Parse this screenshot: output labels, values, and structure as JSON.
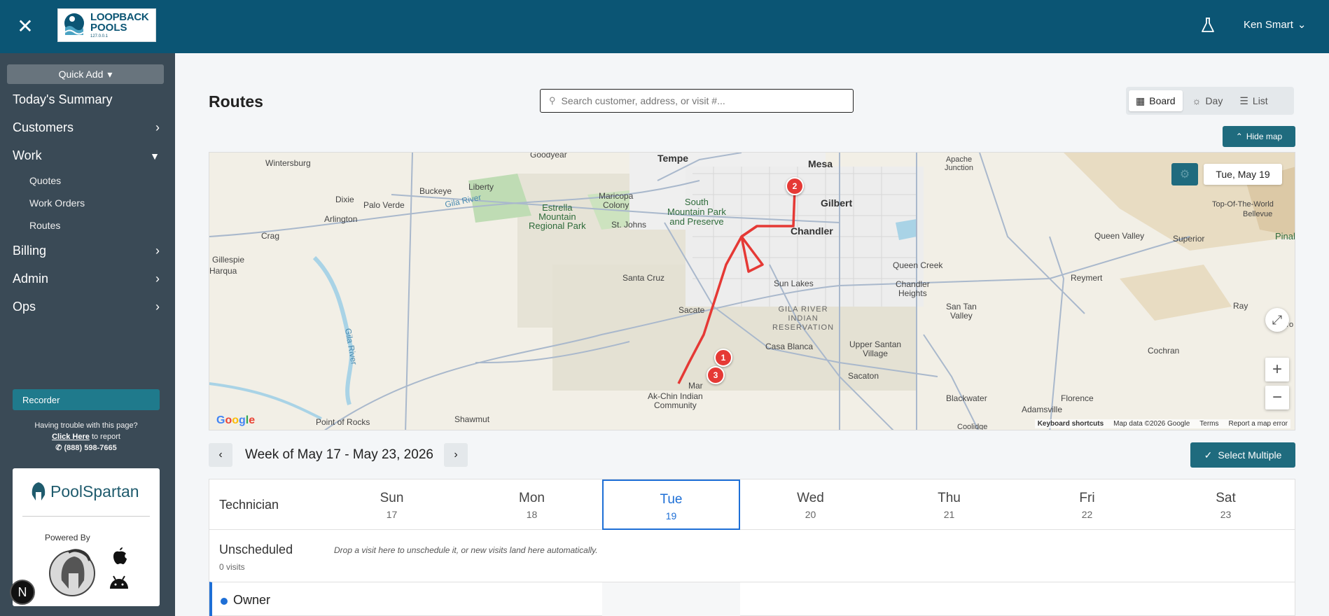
{
  "header": {
    "logo": {
      "line1": "LOOPBACK",
      "line2": "POOLS",
      "line3": "127.0.0.1"
    },
    "user_name": "Ken Smart"
  },
  "sidebar": {
    "quick_add": "Quick Add",
    "items": [
      {
        "label": "Today's Summary"
      },
      {
        "label": "Customers"
      },
      {
        "label": "Work"
      },
      {
        "label": "Billing"
      },
      {
        "label": "Admin"
      },
      {
        "label": "Ops"
      }
    ],
    "work_sub": [
      "Quotes",
      "Work Orders",
      "Routes"
    ],
    "recorder": "Recorder",
    "help": {
      "line1": "Having trouble with this page?",
      "link": "Click Here",
      "link_suffix": " to report",
      "phone": "(888) 598-7665"
    },
    "spartan": {
      "name": "PoolSpartan",
      "powered_by": "Powered By"
    },
    "badge": "N"
  },
  "main": {
    "title": "Routes",
    "search_placeholder": "Search customer, address, or visit #...",
    "views": [
      {
        "label": "Board",
        "active": true
      },
      {
        "label": "Day",
        "active": false
      },
      {
        "label": "List",
        "active": false
      }
    ],
    "hide_map": "Hide map",
    "map": {
      "date": "Tue, May 19",
      "google": "Google",
      "footer": [
        "Keyboard shortcuts",
        "Map data ©2026 Google",
        "Terms",
        "Report a map error"
      ],
      "markers": [
        "1",
        "2",
        "3"
      ],
      "labels": {
        "tempe": "Tempe",
        "mesa": "Mesa",
        "gilbert": "Gilbert",
        "chandler": "Chandler",
        "apache": "Apache\nJunction",
        "wintersburg": "Wintersburg",
        "buckeye": "Buckeye",
        "liberty": "Liberty",
        "goodyear": "Goodyear",
        "dixie": "Dixie",
        "palo_verde": "Palo Verde",
        "gila_river": "Gila River",
        "arlington": "Arlington",
        "crag": "Crag",
        "gillespie": "Gillespie",
        "harqua": "Harqua",
        "estrella": "Estrella\nMountain\nRegional Park",
        "maricopa_colony": "Maricopa\nColony",
        "st_johns": "St. Johns",
        "south_mountain": "South\nMountain Park\nand Preserve",
        "santa_cruz": "Santa Cruz",
        "sacate": "Sacate",
        "sun_lakes": "Sun Lakes",
        "chandler_heights": "Chandler\nHeights",
        "queen_creek": "Queen Creek",
        "queen_valley": "Queen Valley",
        "superior": "Superior",
        "top_of_world": "Top-Of-The-World",
        "bellevue": "Bellevue",
        "pinal": "Pinal",
        "reymert": "Reymert",
        "ray": "Ray",
        "san_tan": "San Tan\nValley",
        "gila_res": "GILA RIVER\nINDIAN\nRESERVATION",
        "casa_blanca": "Casa Blanca",
        "upper_santan": "Upper Santan\nVillage",
        "sacaton": "Sacaton",
        "cochran": "Cochran",
        "ak_chin": "Ak-Chin Indian\nCommunity",
        "maricopa": "Mar",
        "blackwater": "Blackwater",
        "florence": "Florence",
        "adamsville": "Adamsville",
        "shawmut": "Shawmut",
        "point_of_rocks": "Point of Rocks",
        "gila_river2": "Gila River",
        "coolidge": "Coolidge",
        "tro": "Tro"
      }
    },
    "week_label": "Week of May 17 - May 23, 2026",
    "select_multiple": "Select Multiple",
    "board": {
      "technician": "Technician",
      "days": [
        {
          "name": "Sun",
          "num": "17"
        },
        {
          "name": "Mon",
          "num": "18"
        },
        {
          "name": "Tue",
          "num": "19",
          "selected": true
        },
        {
          "name": "Wed",
          "num": "20"
        },
        {
          "name": "Thu",
          "num": "21"
        },
        {
          "name": "Fri",
          "num": "22"
        },
        {
          "name": "Sat",
          "num": "23"
        }
      ],
      "unscheduled": "Unscheduled",
      "unscheduled_count": "0 visits",
      "unscheduled_hint": "Drop a visit here to unschedule it, or new visits land here automatically.",
      "owner": "Owner"
    }
  },
  "colors": {
    "header": "#0b5574",
    "sidebar": "#3a4a56",
    "accent": "#1f6b7e",
    "selected": "#1e6fd6",
    "route": "#e53935"
  }
}
